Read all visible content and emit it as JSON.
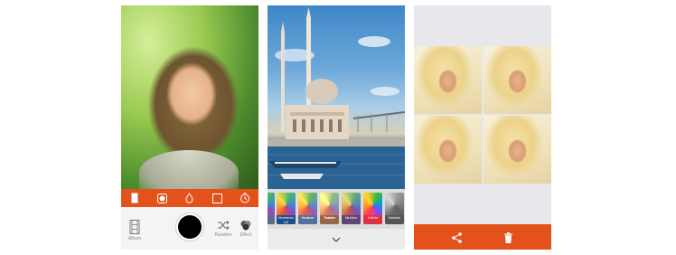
{
  "colors": {
    "accent": "#e4521b",
    "toolbar_bg": "#f4f4f4"
  },
  "camera": {
    "filter_bar_icons": [
      "rect-frame-icon",
      "circle-frame-icon",
      "drop-icon",
      "square-outline-icon",
      "timer-icon"
    ],
    "tools": {
      "left_label": "Album",
      "random_label": "Random",
      "effect_label": "Effect"
    }
  },
  "filters": {
    "items": [
      {
        "label": ""
      },
      {
        "label": "Momento Lili"
      },
      {
        "label": "Hudson"
      },
      {
        "label": "Toaster"
      },
      {
        "label": "Mulden"
      },
      {
        "label": "Kelvin"
      },
      {
        "label": "Walden"
      }
    ]
  },
  "collage": {
    "actions": [
      "share-icon",
      "trash-icon"
    ]
  }
}
